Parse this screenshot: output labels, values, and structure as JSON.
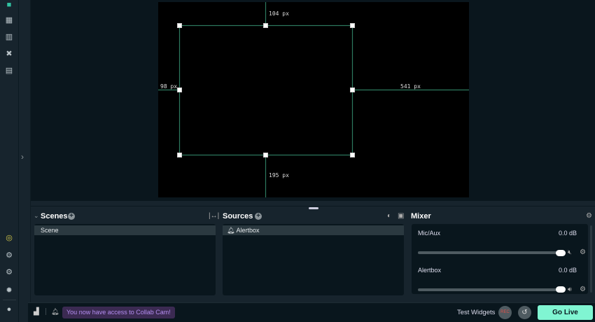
{
  "sidebar": {
    "icons": [
      "studio-icon",
      "dashboard-icon",
      "layout-icon",
      "themes-icon",
      "media-icon"
    ],
    "bottom_icons": [
      "collab-cam-icon",
      "apps-icon",
      "app-store-icon",
      "settings-icon",
      "profile-icon"
    ]
  },
  "preview": {
    "distances": {
      "top": "104 px",
      "left": "98 px",
      "right": "541 px",
      "bottom": "195 px"
    }
  },
  "scenes": {
    "title": "Scenes",
    "items": [
      "Scene"
    ]
  },
  "sources": {
    "title": "Sources",
    "items": [
      "Alertbox"
    ]
  },
  "mixer": {
    "title": "Mixer",
    "channels": [
      {
        "name": "Mic/Aux",
        "level": "0.0 dB",
        "volume": 1.0,
        "muted": true
      },
      {
        "name": "Alertbox",
        "level": "0.0 dB",
        "volume": 1.0,
        "muted": false
      }
    ]
  },
  "footer": {
    "notification": "You now have access to Collab Cam!",
    "test_widgets": "Test Widgets",
    "rec": "REC",
    "go_live": "Go Live"
  },
  "colors": {
    "accent": "#80f5d2",
    "guide": "#2d7a5e",
    "notice": "#b48ef0"
  }
}
